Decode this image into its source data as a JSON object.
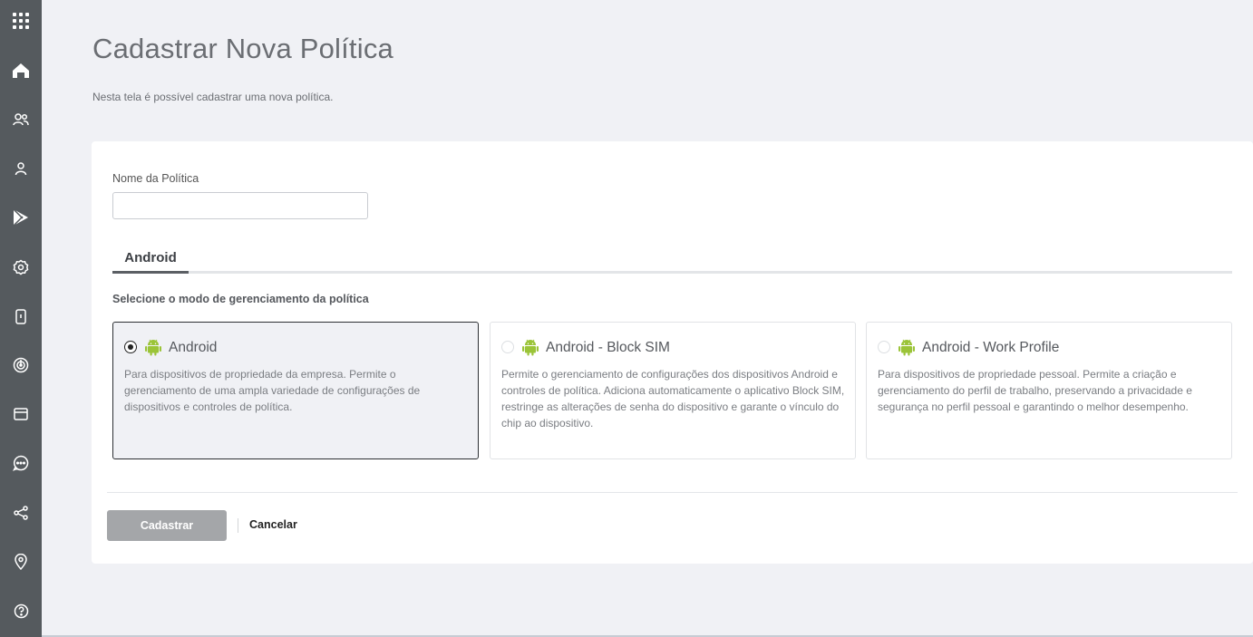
{
  "sidebar": {
    "items": [
      {
        "icon": "apps-grid-icon"
      },
      {
        "icon": "home-icon"
      },
      {
        "icon": "users-icon"
      },
      {
        "icon": "user-icon"
      },
      {
        "icon": "play-store-icon"
      },
      {
        "icon": "settings-icon"
      },
      {
        "icon": "device-icon"
      },
      {
        "icon": "radar-icon"
      },
      {
        "icon": "window-icon"
      },
      {
        "icon": "chat-icon"
      },
      {
        "icon": "share-icon"
      },
      {
        "icon": "location-pin-icon"
      },
      {
        "icon": "help-icon"
      }
    ]
  },
  "page": {
    "title": "Cadastrar Nova Política",
    "subtitle": "Nesta tela é possível cadastrar uma nova política."
  },
  "form": {
    "name_label": "Nome da Política",
    "name_value": "",
    "tab_label": "Android",
    "mode_heading": "Selecione o modo de gerenciamento da política",
    "options": [
      {
        "title": "Android",
        "description": "Para dispositivos de propriedade da empresa. Permite o gerenciamento de uma ampla variedade de configurações de dispositivos e controles de política.",
        "selected": true
      },
      {
        "title": "Android - Block SIM",
        "description": "Permite o gerenciamento de configurações dos dispositivos Android e controles de política. Adiciona automaticamente o aplicativo Block SIM, restringe as alterações de senha do dispositivo e garante o vínculo do chip ao dispositivo.",
        "selected": false
      },
      {
        "title": "Android - Work Profile",
        "description": "Para dispositivos de propriedade pessoal. Permite a criação e gerenciamento do perfil de trabalho, preservando a privacidade e segurança no perfil pessoal e garantindo o melhor desempenho.",
        "selected": false
      }
    ]
  },
  "actions": {
    "submit_label": "Cadastrar",
    "cancel_label": "Cancelar"
  },
  "colors": {
    "sidebar_bg": "#555a5e",
    "android_green": "#9bc438",
    "page_bg": "#f0f1f5"
  }
}
